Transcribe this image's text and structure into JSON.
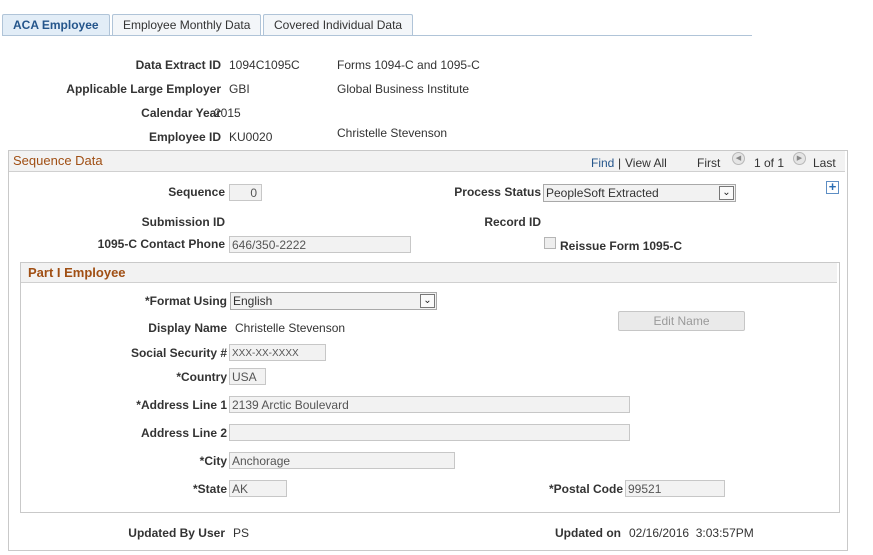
{
  "tabs": [
    {
      "label": "ACA Employee"
    },
    {
      "label": "Employee Monthly Data"
    },
    {
      "label": "Covered Individual Data"
    }
  ],
  "header": {
    "data_extract_id_label": "Data Extract ID",
    "data_extract_id": "1094C1095C",
    "data_extract_desc": "Forms 1094-C and 1095-C",
    "ale_label": "Applicable Large Employer",
    "ale": "GBI",
    "ale_desc": "Global Business Institute",
    "calendar_year_label": "Calendar Year",
    "calendar_year": "2015",
    "employee_id_label": "Employee ID",
    "employee_id": "KU0020",
    "employee_name": "Christelle Stevenson"
  },
  "sequence_data": {
    "title": "Sequence Data",
    "nav": {
      "find": "Find",
      "separator": "|",
      "view_all": "View All",
      "first": "First",
      "range": "1 of 1",
      "last": "Last"
    },
    "sequence_label": "Sequence",
    "sequence": "0",
    "process_status_label": "Process Status",
    "process_status": "PeopleSoft Extracted",
    "submission_id_label": "Submission ID",
    "record_id_label": "Record ID",
    "contact_phone_label": "1095-C Contact Phone",
    "contact_phone": "646/350-2222",
    "reissue_label": "Reissue Form 1095-C"
  },
  "part1": {
    "title": "Part I Employee",
    "format_using_label": "*Format Using",
    "format_using": "English",
    "display_name_label": "Display Name",
    "display_name": "Christelle Stevenson",
    "edit_name_button": "Edit Name",
    "ssn_label": "Social Security #",
    "ssn": "XXX-XX-XXXX",
    "country_label": "*Country",
    "country": "USA",
    "address1_label": "*Address Line 1",
    "address1": "2139 Arctic Boulevard",
    "address2_label": "Address Line 2",
    "address2": "",
    "city_label": "*City",
    "city": "Anchorage",
    "state_label": "*State",
    "state": "AK",
    "postal_label": "*Postal Code",
    "postal": "99521"
  },
  "footer": {
    "updated_by_label": "Updated By User",
    "updated_by": "PS",
    "updated_on_label": "Updated on",
    "updated_on": "02/16/2016  3:03:57PM"
  },
  "icons": {
    "first": "arrow-left-icon",
    "last": "arrow-right-icon",
    "add": "plus-icon",
    "dropdown": "chevron-down-icon"
  }
}
